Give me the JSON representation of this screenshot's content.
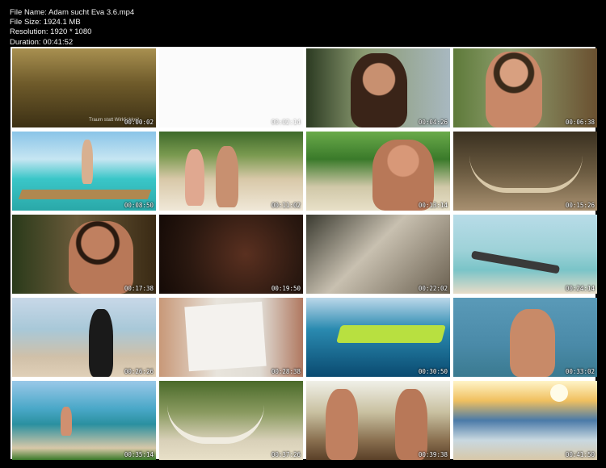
{
  "file_info": {
    "name": "File Name: Adam sucht Eva 3.6.mp4",
    "size": "File Size: 1924.1 MB",
    "resolution": "Resolution: 1920 * 1080",
    "duration": "Duration: 00:41:52"
  },
  "watermark": "Traum statt Wirklichkeit",
  "thumbnails": [
    {
      "timestamp": "00:00:02"
    },
    {
      "timestamp": "00:02:14"
    },
    {
      "timestamp": "00:04:26"
    },
    {
      "timestamp": "00:06:38"
    },
    {
      "timestamp": "00:08:50"
    },
    {
      "timestamp": "00:11:02"
    },
    {
      "timestamp": "00:13:14"
    },
    {
      "timestamp": "00:15:26"
    },
    {
      "timestamp": "00:17:38"
    },
    {
      "timestamp": "00:19:50"
    },
    {
      "timestamp": "00:22:02"
    },
    {
      "timestamp": "00:24:14"
    },
    {
      "timestamp": "00:26:26"
    },
    {
      "timestamp": "00:28:38"
    },
    {
      "timestamp": "00:30:50"
    },
    {
      "timestamp": "00:33:02"
    },
    {
      "timestamp": "00:35:14"
    },
    {
      "timestamp": "00:37:26"
    },
    {
      "timestamp": "00:39:38"
    },
    {
      "timestamp": "00:41:50"
    }
  ]
}
